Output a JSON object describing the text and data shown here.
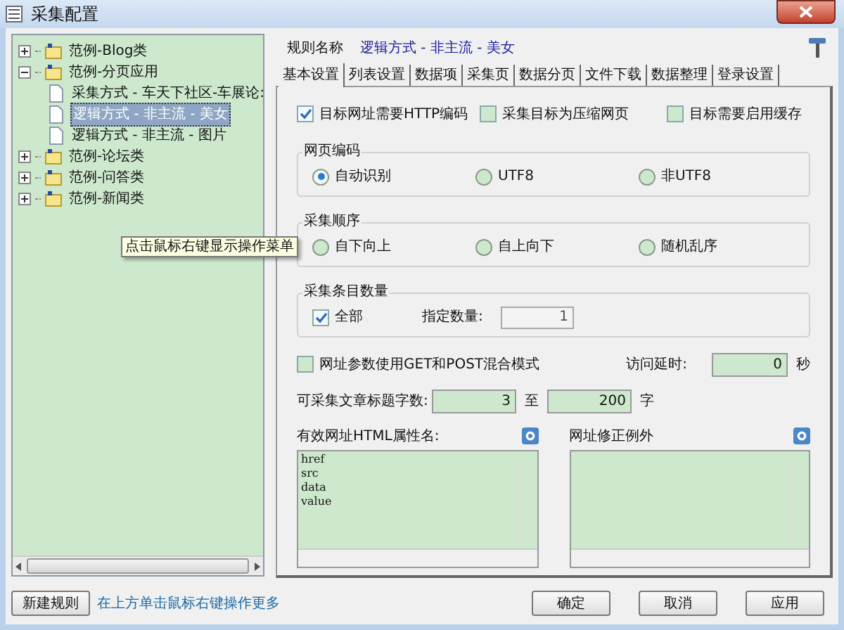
{
  "window": {
    "title": "采集配置"
  },
  "tree": [
    {
      "label": "范例-Blog类",
      "expanded": false
    },
    {
      "label": "范例-分页应用",
      "expanded": true,
      "children": [
        {
          "label": "采集方式 - 车天下社区-车展论:",
          "selected": false
        },
        {
          "label": "逻辑方式 - 非主流 - 美女",
          "selected": true
        },
        {
          "label": "逻辑方式 - 非主流 - 图片",
          "selected": false
        }
      ]
    },
    {
      "label": "范例-论坛类",
      "expanded": false
    },
    {
      "label": "范例-问答类",
      "expanded": false
    },
    {
      "label": "范例-新闻类",
      "expanded": false
    }
  ],
  "tooltip": "点击鼠标右键显示操作菜单",
  "rule_name": {
    "label": "规则名称",
    "value": "逻辑方式 - 非主流 - 美女"
  },
  "tabs": [
    {
      "label": "基本设置",
      "selected": true
    },
    {
      "label": "列表设置",
      "selected": false
    },
    {
      "label": "数据项",
      "selected": false
    },
    {
      "label": "采集页",
      "selected": false
    },
    {
      "label": "数据分页",
      "selected": false
    },
    {
      "label": "文件下载",
      "selected": false
    },
    {
      "label": "数据整理",
      "selected": false
    },
    {
      "label": "登录设置",
      "selected": false
    }
  ],
  "top_options": [
    {
      "label": "目标网址需要HTTP编码",
      "checked": true
    },
    {
      "label": "采集目标为压缩网页",
      "checked": false
    },
    {
      "label": "目标需要启用缓存",
      "checked": false
    }
  ],
  "encoding": {
    "title": "网页编码",
    "options": [
      {
        "label": "自动识别",
        "selected": true
      },
      {
        "label": "UTF8",
        "selected": false
      },
      {
        "label": "非UTF8",
        "selected": false
      }
    ]
  },
  "order": {
    "title": "采集顺序",
    "options": [
      {
        "label": "自下向上",
        "selected": false
      },
      {
        "label": "自上向下",
        "selected": false
      },
      {
        "label": "随机乱序",
        "selected": false
      }
    ]
  },
  "count": {
    "title": "采集条目数量",
    "all": {
      "label": "全部",
      "checked": true
    },
    "specified_label": "指定数量:",
    "specified_value": "1"
  },
  "mixed_mode": {
    "label": "网址参数使用GET和POST混合模式",
    "checked": false
  },
  "delay": {
    "label": "访问延时:",
    "value": "0",
    "unit": "秒"
  },
  "title_length": {
    "label": "可采集文章标题字数:",
    "min": "3",
    "to": "至",
    "max": "200",
    "unit": "字"
  },
  "html_attributes": {
    "label": "有效网址HTML属性名:",
    "lines": [
      "href",
      "src",
      "data",
      "value"
    ]
  },
  "url_exceptions": {
    "label": "网址修正例外"
  },
  "new_rule_button": "新建规则",
  "hint": "在上方单击鼠标右键操作更多",
  "buttons": [
    "确定",
    "取消",
    "应用"
  ]
}
